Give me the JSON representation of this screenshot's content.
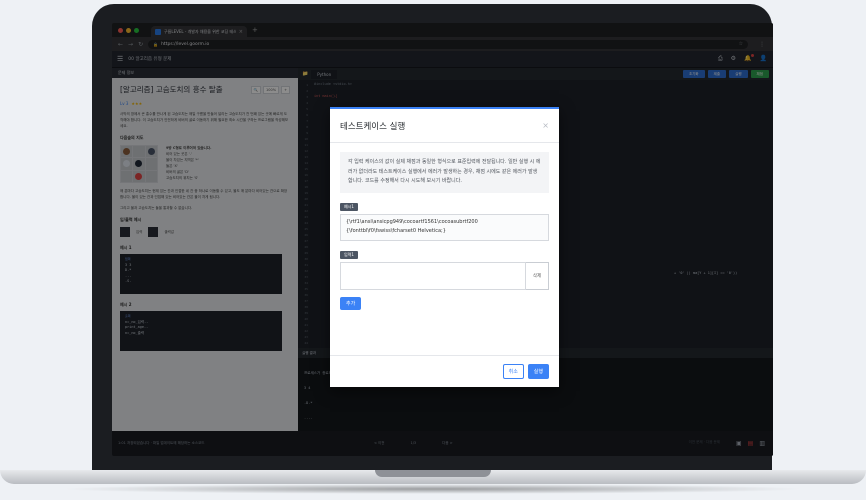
{
  "browser": {
    "tab_title": "구름LEVEL - 개발자 채용을 위한 코딩 테스트",
    "new_tab": "+",
    "url": "https://level.goorm.io",
    "colors": {
      "close": "#ff5f57",
      "min": "#febc2e",
      "max": "#28c840"
    }
  },
  "header": {
    "breadcrumb": "00 알고리즘 유형 문제"
  },
  "problem": {
    "panel_label": "문제 정보",
    "title": "[알고리즘] 고슴도치의 흥수 탈출",
    "zoom_label": "100%",
    "level": "Lv 3",
    "stars": "★★★",
    "paragraph1": "사막의 땅에서 큰 홍수를 만나게 된 고슴도치는 매일 구름을 만들어 달리는 고슴도치가 천 번째 있는 곳에 빠르게 도착해야 합니다. 이 고슴도치가 안전하게 비버의 굴로 이동하기 위해 필요한 최소 시간을 구하는 프로그램을 작성해보세요.",
    "legend_title": "다음숲의 지도",
    "legend_items": [
      "비어 있는 곳은 '.'",
      "물이 차있는 지역은 '*'",
      "돌은 'X'",
      "비버의 굴은 'D'",
      "고슴도치의 위치는 'S'"
    ],
    "legend_heading": "9방 C형로 이루어져 있습니다.",
    "paragraph2": "매 분마다 고슴도치는 현재 있는 칸과 인접한 네 칸 중 하나로 이동할 수 있고, 물도 매 분마다 비어있는 칸으로 확장합니다. 물이 있는 칸과 인접해 있는 비어있는 칸은 물이 차게 됩니다.",
    "paragraph3": "그리고 물과 고슴도치는 돌을 통과할 수 없습니다.",
    "io_title": "입/출력 예시",
    "io_legend_in": "입력",
    "io_legend_out": "출력값",
    "example1_label": "예시 1",
    "example1_tag": "입력",
    "example1_lines": [
      "3 3",
      "D.*",
      "...",
      ".S."
    ],
    "example2_label": "예시 2",
    "example2_tag": "출력",
    "example2_lines": [
      "n=_no_입력--",
      "print_age--",
      "n=_no_출력"
    ]
  },
  "editor": {
    "file_tab": "Python",
    "buttons": [
      "초기화",
      "제출",
      "실행",
      "채점"
    ],
    "line_numbers": [
      "1",
      "2",
      "3",
      "4",
      "5",
      "6",
      "7",
      "8",
      "9",
      "10",
      "11",
      "12",
      "13",
      "14",
      "15",
      "16",
      "17",
      "18",
      "19",
      "20",
      "21",
      "22",
      "23",
      "24",
      "25",
      "26",
      "27",
      "28",
      "29",
      "30",
      "31",
      "32",
      "33",
      "34",
      "35",
      "36",
      "37",
      "38",
      "39",
      "40",
      "41",
      "42",
      "43",
      "44"
    ],
    "code_line1": "#include <stdio.h>",
    "code_line3": "int main(){",
    "code_line_mid": "+ '0' || ma[Y + 1][I] == '0'))",
    "run_header": "실행 결과",
    "output_lines": [
      "프로세스가 종료되었습니다.",
      "3 4",
      ".D.*",
      "....",
      ".S..",
      "S.*."
    ]
  },
  "status": {
    "left": "1:01 저장되었습니다 · 파일 업데이트에 해당하는 소스코드",
    "prev": "< 이전",
    "page": "1/3",
    "next": "다음 >",
    "right_text": "이전 문제 · 다음 문제"
  },
  "modal": {
    "title": "테스트케이스 실행",
    "close": "×",
    "info": "각 입력 케이스의 값이 실제 채점과 동일한 형식으로 표준입력에 전달됩니다. 일반 실행 시 에러가 없더라도 테스트케이스 실행에서 에러가 발생하는 경우, 채점 시에도 같은 에러가 발생합니다. 코드를 수정해서 다시 시도해 보시기 바랍니다.",
    "example_chip": "예시1",
    "example_value": "{\\rtf1\\ansi\\ansicpg949\\cocoartf1561\\cocoasubrtf200 {\\fonttbl\\f0\\fswiss\\fcharset0 Helvetica;}",
    "input_chip": "입력1",
    "delete_label": "삭제",
    "add_label": "추가",
    "cancel_label": "취소",
    "run_label": "실행"
  }
}
